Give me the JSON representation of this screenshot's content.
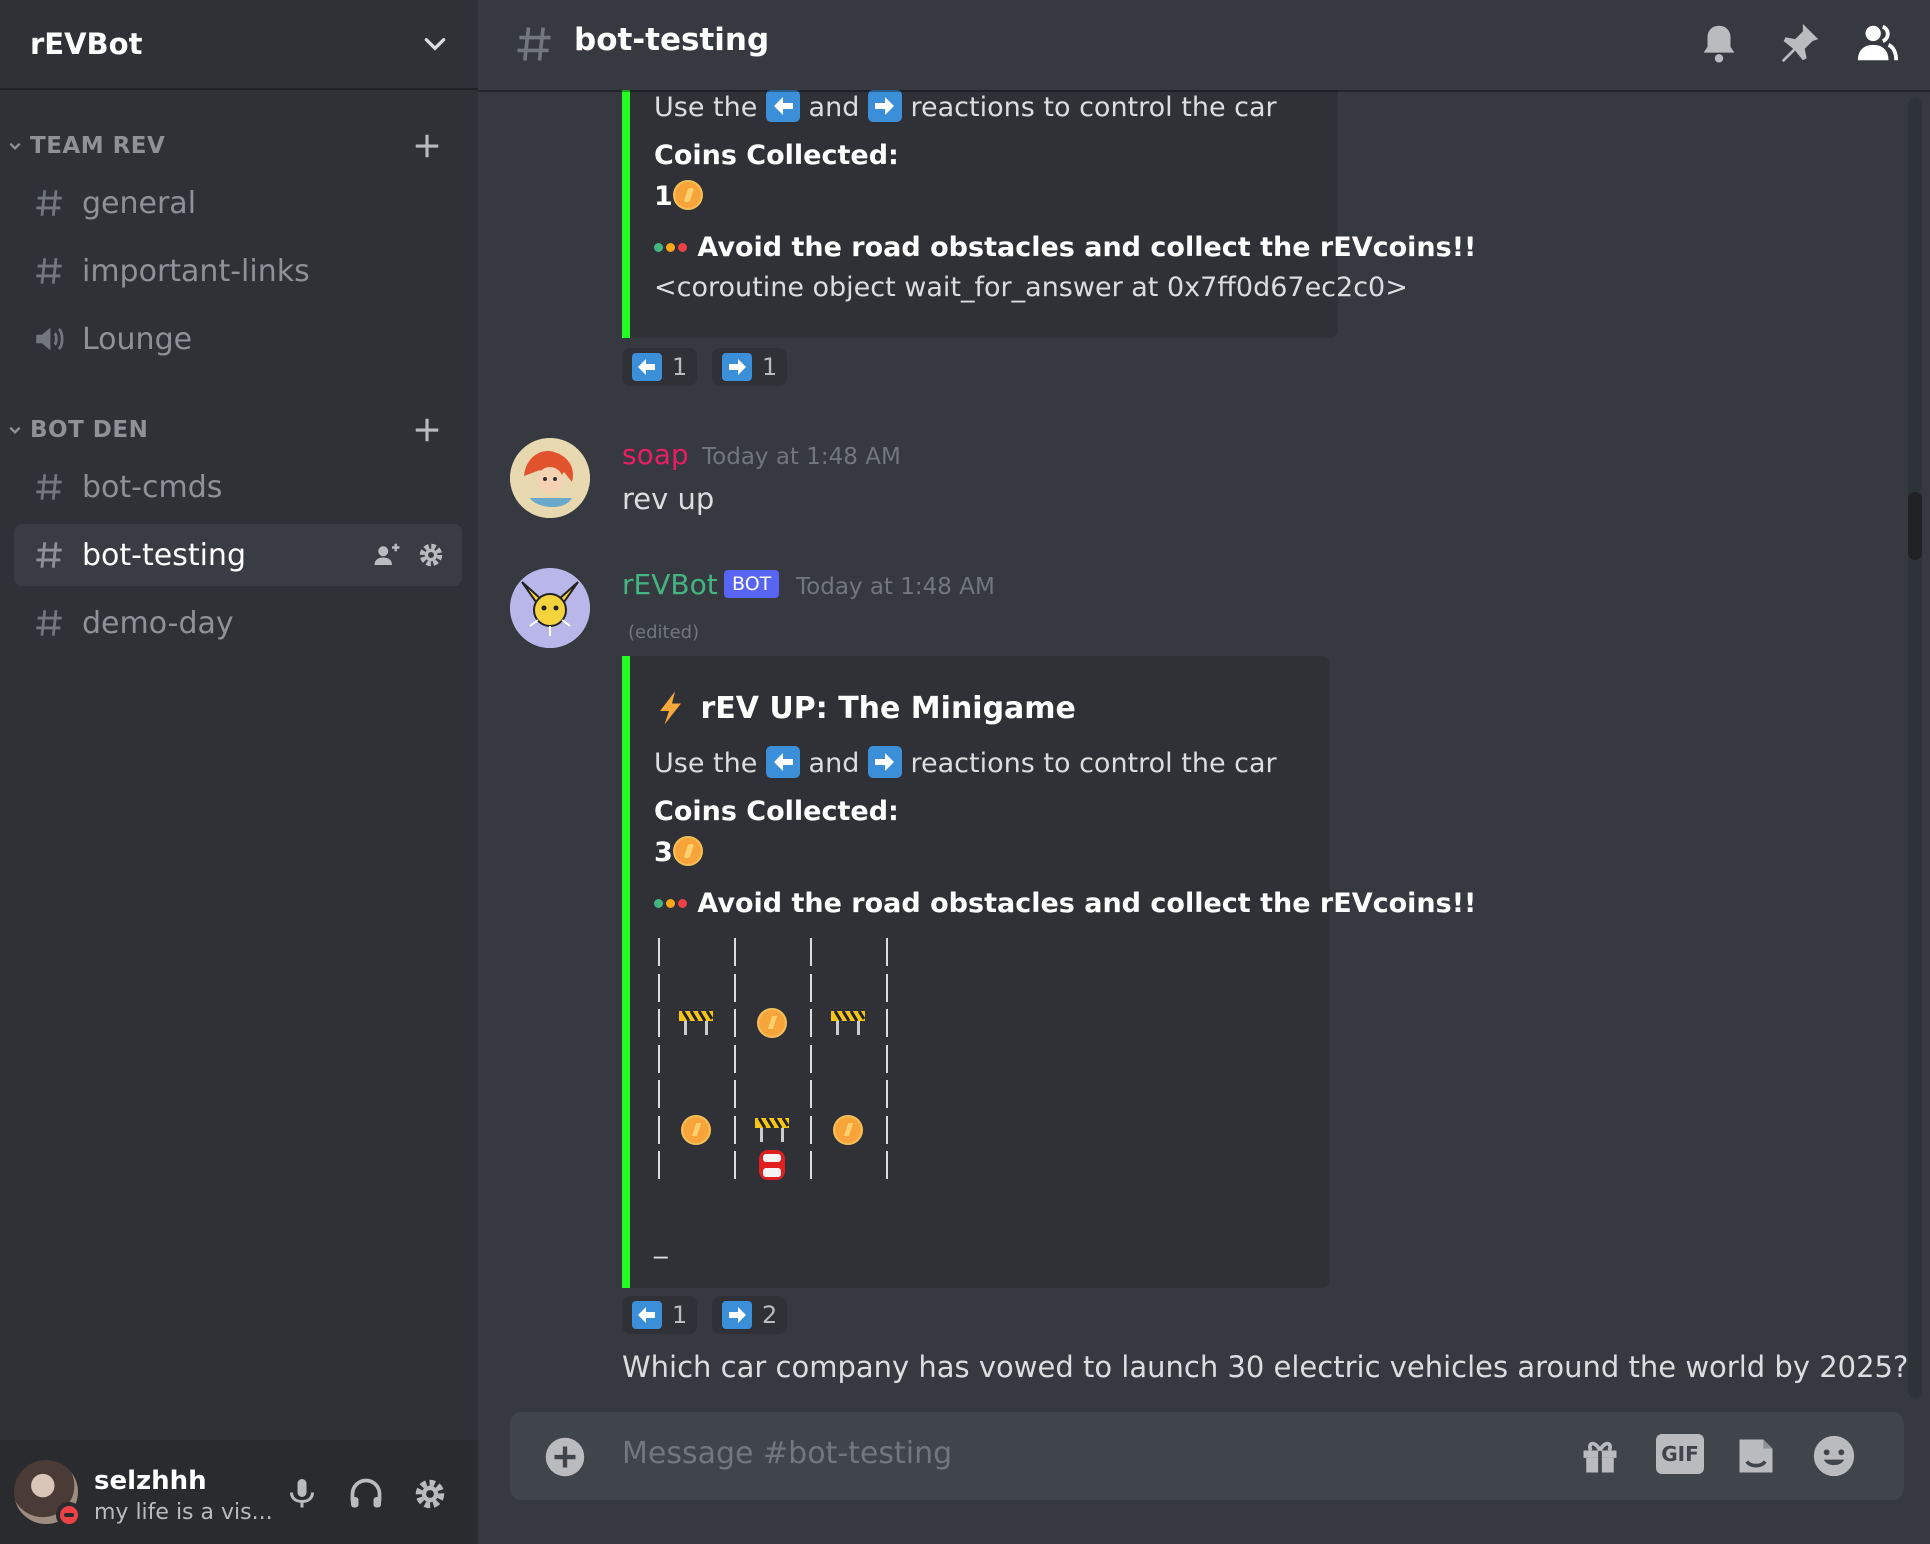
{
  "server": {
    "name": "rEVBot"
  },
  "sidebar": {
    "categories": [
      {
        "label": "TEAM REV"
      },
      {
        "label": "BOT DEN"
      }
    ],
    "channels": [
      {
        "label": "general",
        "type": "text"
      },
      {
        "label": "important-links",
        "type": "text"
      },
      {
        "label": "Lounge",
        "type": "voice"
      },
      {
        "label": "bot-cmds",
        "type": "text"
      },
      {
        "label": "bot-testing",
        "type": "text",
        "active": true
      },
      {
        "label": "demo-day",
        "type": "text"
      }
    ]
  },
  "user": {
    "name": "selzhhh",
    "status": "my life is a vis..."
  },
  "header": {
    "channel": "bot-testing"
  },
  "messages": {
    "embed1": {
      "controls_prefix": "Use the",
      "controls_mid": "and",
      "controls_suffix": "reactions to control the car",
      "coins_label": "Coins Collected:",
      "coins_value": "1",
      "objective": "Avoid the road obstacles and collect the rEVcoins!!",
      "debug": "<coroutine object wait_for_answer at 0x7ff0d67ec2c0>",
      "reactions": [
        {
          "icon": "left-arrow",
          "count": "1"
        },
        {
          "icon": "right-arrow",
          "count": "1"
        }
      ]
    },
    "soap": {
      "author": "soap",
      "time": "Today at 1:48 AM",
      "text": "rev up"
    },
    "bot": {
      "author": "rEVBot",
      "tag": "BOT",
      "time": "Today at 1:48 AM",
      "edited": "(edited)",
      "embed_title": "rEV UP: The Minigame",
      "controls_prefix": "Use the",
      "controls_mid": "and",
      "controls_suffix": "reactions to control the car",
      "coins_label": "Coins Collected:",
      "coins_value": "3",
      "objective": "Avoid the road obstacles and collect the rEVcoins!!",
      "road_rows": [
        [
          "",
          "",
          ""
        ],
        [
          "",
          "",
          ""
        ],
        [
          "barrier",
          "coin",
          "barrier"
        ],
        [
          "",
          "",
          ""
        ],
        [
          "",
          "",
          ""
        ],
        [
          "coin",
          "barrier",
          "coin"
        ],
        [
          "",
          "car",
          ""
        ]
      ],
      "footer_mark": "_",
      "reactions": [
        {
          "icon": "left-arrow",
          "count": "1"
        },
        {
          "icon": "right-arrow",
          "count": "2"
        }
      ],
      "question": "Which car company has vowed to launch 30 electric vehicles around the world by 2025?"
    }
  },
  "composer": {
    "placeholder": "Message #bot-testing",
    "gif_label": "GIF"
  },
  "colors": {
    "accent": "#5865f2",
    "embed_bar": "#23ff23",
    "soap_name": "#e91e63",
    "bot_name": "#43b581"
  }
}
